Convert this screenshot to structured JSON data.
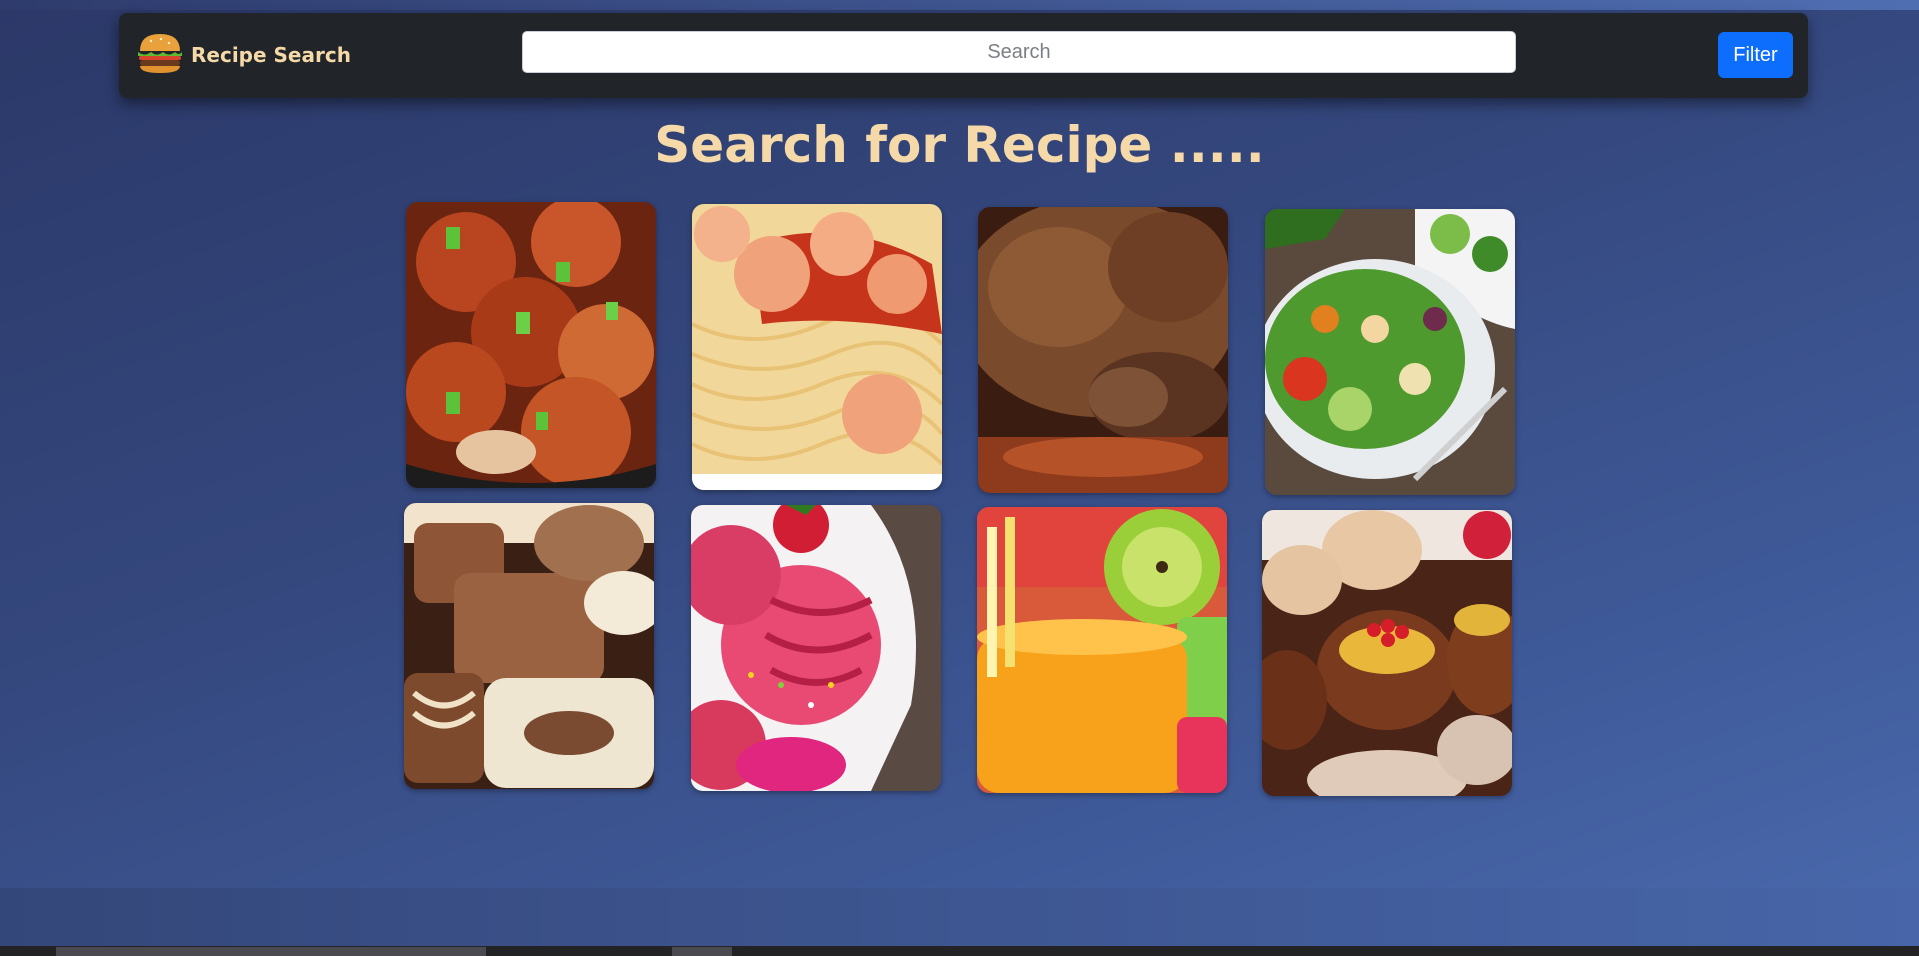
{
  "navbar": {
    "brand": {
      "icon": "burger-icon",
      "label": "Recipe Search"
    },
    "search": {
      "placeholder": "Search",
      "value": ""
    },
    "filter_label": "Filter"
  },
  "main": {
    "heading": "Search for Recipe .....",
    "recipes": [
      {
        "icon": "chicken-curry-image"
      },
      {
        "icon": "shrimp-pasta-image"
      },
      {
        "icon": "roast-chicken-image"
      },
      {
        "icon": "salad-bowl-image"
      },
      {
        "icon": "chocolates-image"
      },
      {
        "icon": "ice-cream-image"
      },
      {
        "icon": "juice-glasses-image"
      },
      {
        "icon": "pastries-image"
      }
    ]
  },
  "colors": {
    "accent": "#f5d9a8",
    "navbar_bg": "#212529",
    "button": "#0d6efd",
    "background_start": "#2b3868",
    "background_end": "#4a6aae"
  }
}
